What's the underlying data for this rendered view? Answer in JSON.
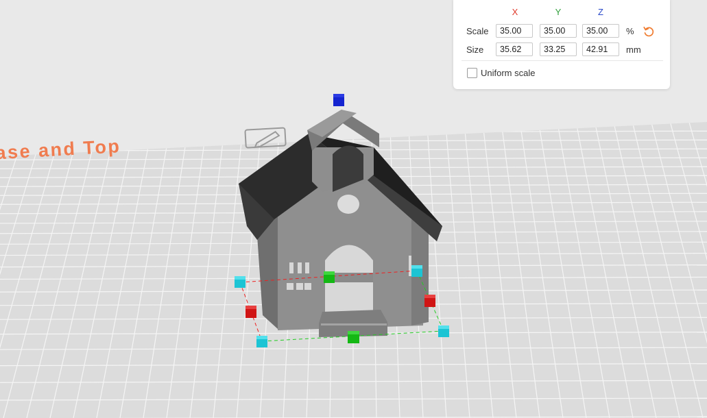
{
  "canvas": {
    "label_text": "ase and Top",
    "label_color": "#f07c4f",
    "edit_icon": "pencil-icon",
    "colors": {
      "background": "#e9e9e9",
      "bed": "#dcdcdc",
      "grid_minor": "#f4f4f4",
      "roof": "#2b2b2b",
      "walls": "#8a8a8a",
      "handle_corner": "#1fc4d4",
      "handle_x": "#d51515",
      "handle_y": "#14b814",
      "handle_z": "#1424d0"
    }
  },
  "scale_panel": {
    "axes": [
      {
        "label": "X",
        "color": "#e03b2d"
      },
      {
        "label": "Y",
        "color": "#2f9e3a"
      },
      {
        "label": "Z",
        "color": "#2747c8"
      }
    ],
    "scale": {
      "label": "Scale",
      "x": "35.00",
      "y": "35.00",
      "z": "35.00",
      "unit": "%"
    },
    "size": {
      "label": "Size",
      "x": "35.62",
      "y": "33.25",
      "z": "42.91",
      "unit": "mm"
    },
    "reset_icon": "reset-icon",
    "reset_color": "#f07c30",
    "uniform_scale": {
      "label": "Uniform scale",
      "checked": false
    }
  }
}
